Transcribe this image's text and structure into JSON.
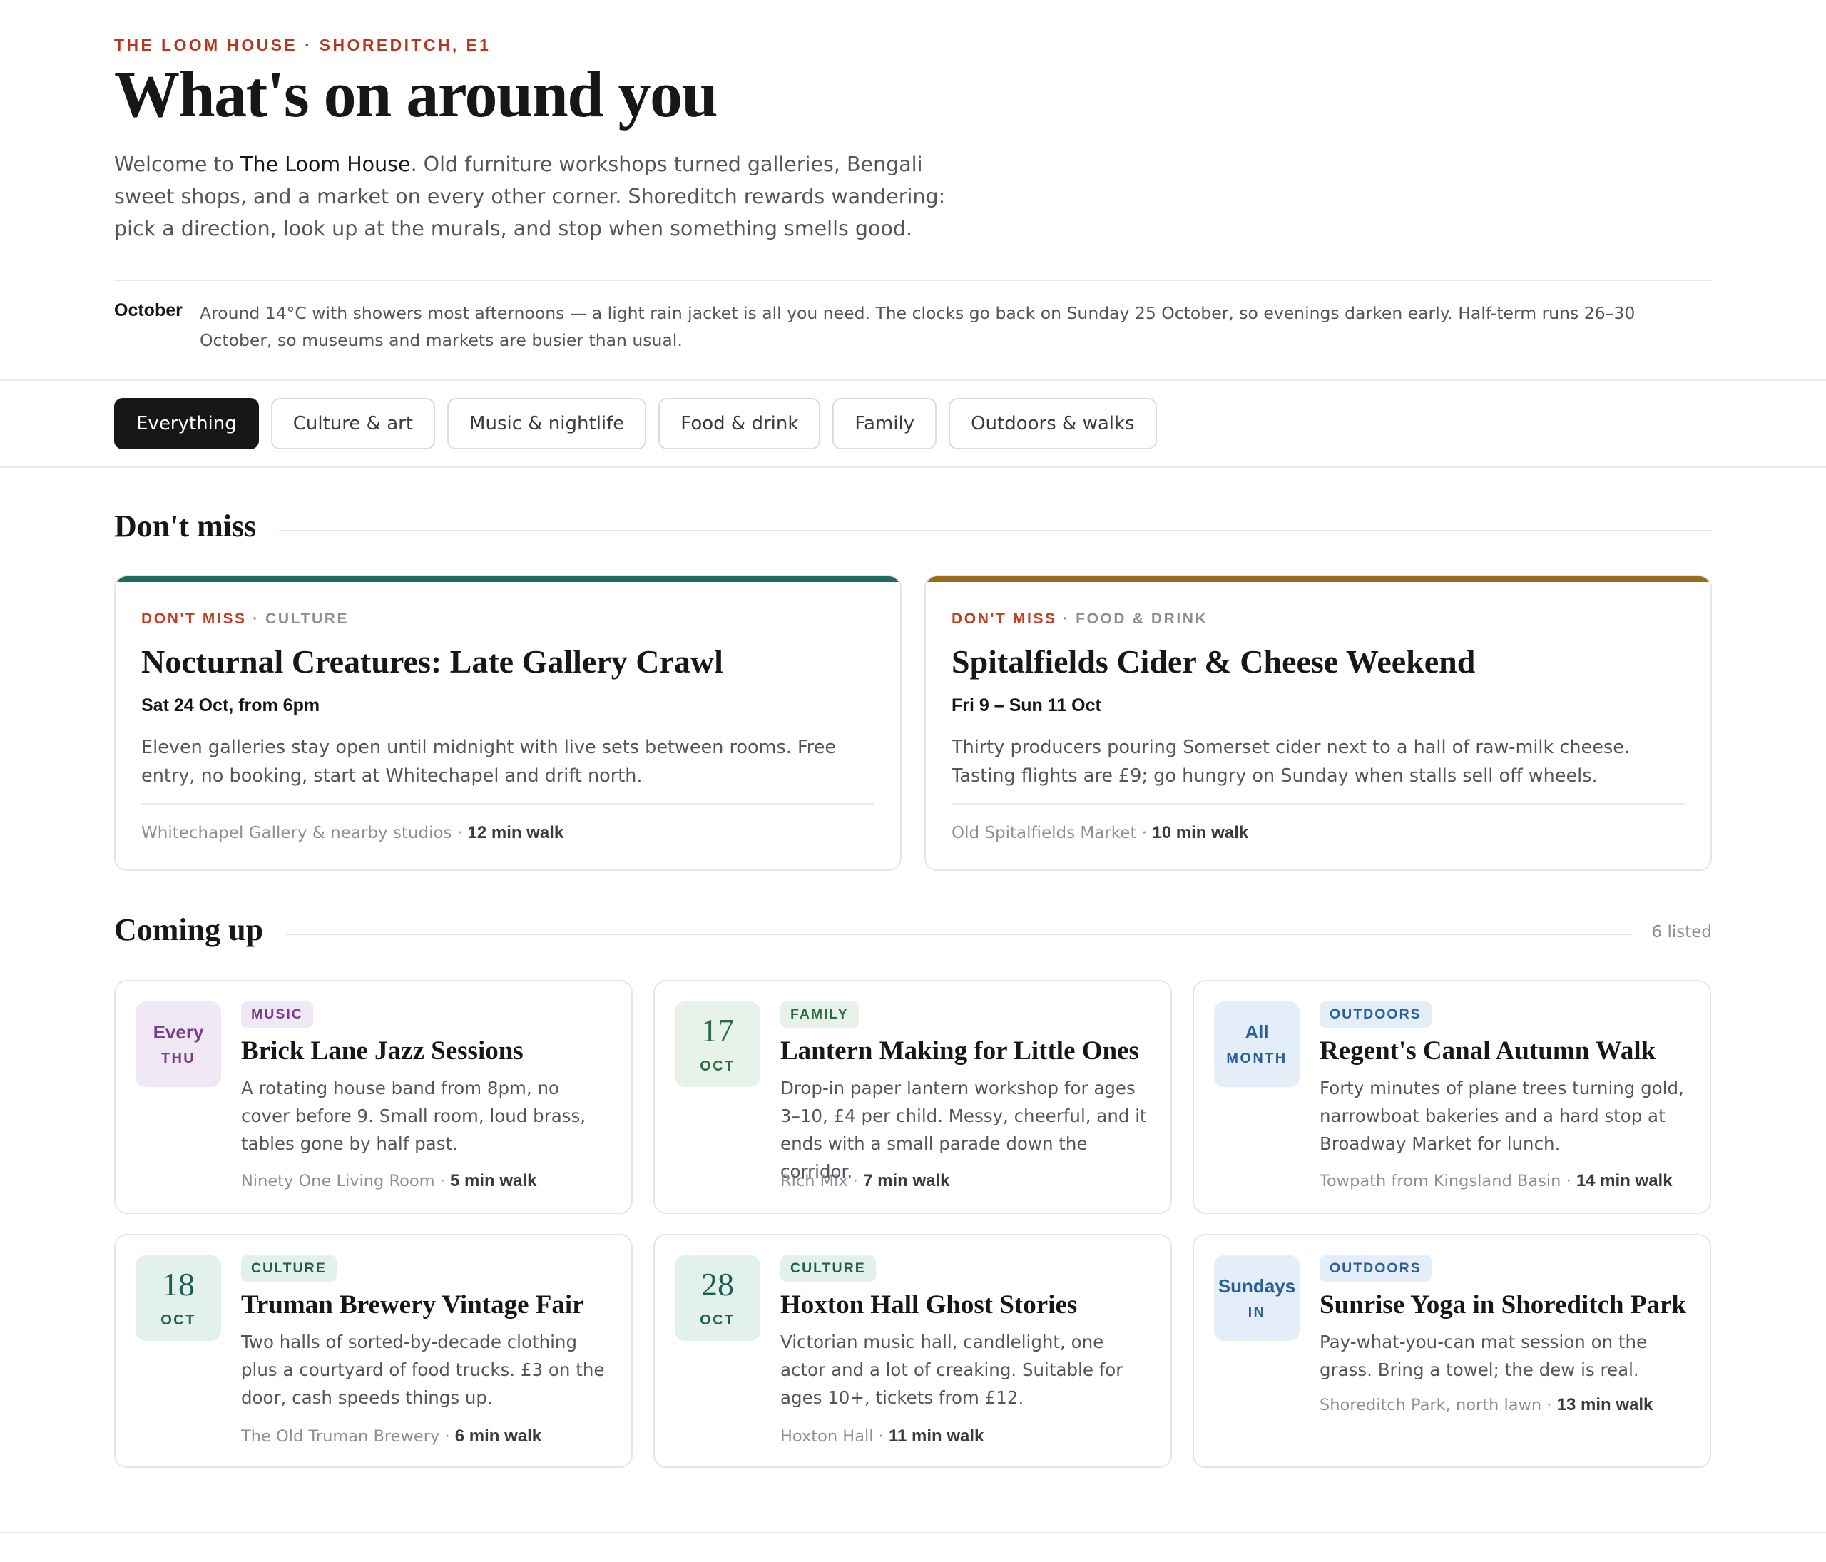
{
  "header": {
    "eyebrow": "THE LOOM HOUSE · SHOREDITCH, E1",
    "title": "What's on around you",
    "intro_prefix": "Welcome to ",
    "intro_name": "The Loom House",
    "intro_rest": ". Old furniture workshops turned galleries, Bengali sweet shops, and a market on every other corner. Shoreditch rewards wandering: pick a direction, look up at the murals, and stop when something smells good."
  },
  "month": {
    "label": "October",
    "text": "Around 14°C with showers most afternoons — a light rain jacket is all you need. The clocks go back on Sunday 25 October, so evenings darken early. Half-term runs 26–30 October, so museums and markets are busier than usual."
  },
  "filters": [
    {
      "label": "Everything",
      "active": true
    },
    {
      "label": "Culture & art",
      "active": false
    },
    {
      "label": "Music & nightlife",
      "active": false
    },
    {
      "label": "Food & drink",
      "active": false
    },
    {
      "label": "Family",
      "active": false
    },
    {
      "label": "Outdoors & walks",
      "active": false
    }
  ],
  "dont_miss": {
    "heading": "Don't miss",
    "items": [
      {
        "kicker": "DON'T MISS",
        "category": "· CULTURE",
        "title": "Nocturnal Creatures: Late Gallery Crawl",
        "date": "Sat 24 Oct, from 6pm",
        "description": "Eleven galleries stay open until midnight with live sets between rooms. Free entry, no booking, start at Whitechapel and drift north.",
        "venue": "Whitechapel Gallery & nearby studios · ",
        "walk": "12 min walk",
        "accent": "#1f6b5c"
      },
      {
        "kicker": "DON'T MISS",
        "category": "· FOOD & DRINK",
        "title": "Spitalfields Cider & Cheese Weekend",
        "date": "Fri 9 – Sun 11 Oct",
        "description": "Thirty producers pouring Somerset cider next to a hall of raw-milk cheese. Tasting flights are £9; go hungry on Sunday when stalls sell off wheels.",
        "venue": "Old Spitalfields Market · ",
        "walk": "10 min walk",
        "accent": "#9a6b1a"
      }
    ]
  },
  "coming_up": {
    "heading": "Coming up",
    "count": "6 listed",
    "events": [
      {
        "date_big": "Every",
        "date_small": "THU",
        "date_is_word": true,
        "tag": "MUSIC",
        "title": "Brick Lane Jazz Sessions",
        "description": "A rotating house band from 8pm, no cover before 9. Small room, loud brass, tables gone by half past.",
        "venue": "Ninety One Living Room · ",
        "walk": "5 min walk",
        "box_bg": "#f1e8f5",
        "box_fg": "#7a3d8c",
        "tag_bg": "#f1e8f5",
        "tag_fg": "#7a3d8c"
      },
      {
        "date_big": "17",
        "date_small": "OCT",
        "date_is_word": false,
        "tag": "FAMILY",
        "title": "Lantern Making for Little Ones",
        "description": "Drop-in paper lantern workshop for ages 3–10, £4 per child. Messy, cheerful, and it ends with a small parade down the corridor.",
        "venue": "Rich Mix · ",
        "walk": "7 min walk",
        "box_bg": "#e6f2ea",
        "box_fg": "#2f6b43",
        "tag_bg": "#e6f2ea",
        "tag_fg": "#2f6b43"
      },
      {
        "date_big": "All",
        "date_small": "MONTH",
        "date_is_word": true,
        "tag": "OUTDOORS",
        "title": "Regent's Canal Autumn Walk",
        "description": "Forty minutes of plane trees turning gold, narrowboat bakeries and a hard stop at Broadway Market for lunch.",
        "venue": "Towpath from Kingsland Basin · ",
        "walk": "14 min walk",
        "box_bg": "#e4eef8",
        "box_fg": "#2a5e9a",
        "tag_bg": "#e4eef8",
        "tag_fg": "#2a5e9a"
      },
      {
        "date_big": "18",
        "date_small": "OCT",
        "date_is_word": false,
        "tag": "CULTURE",
        "title": "Truman Brewery Vintage Fair",
        "description": "Two halls of sorted-by-decade clothing plus a courtyard of food trucks. £3 on the door, cash speeds things up.",
        "venue": "The Old Truman Brewery · ",
        "walk": "6 min walk",
        "box_bg": "#e3f1ec",
        "box_fg": "#1f5e50",
        "tag_bg": "#e3f1ec",
        "tag_fg": "#1f5e50"
      },
      {
        "date_big": "28",
        "date_small": "OCT",
        "date_is_word": false,
        "tag": "CULTURE",
        "title": "Hoxton Hall Ghost Stories",
        "description": "Victorian music hall, candlelight, one actor and a lot of creaking. Suitable for ages 10+, tickets from £12.",
        "venue": "Hoxton Hall · ",
        "walk": "11 min walk",
        "box_bg": "#e3f1ec",
        "box_fg": "#1f5e50",
        "tag_bg": "#e3f1ec",
        "tag_fg": "#1f5e50"
      },
      {
        "date_big": "Sundays",
        "date_small": "IN",
        "date_is_word": true,
        "tag": "OUTDOORS",
        "title": "Sunrise Yoga in Shoreditch Park",
        "description": "Pay-what-you-can mat session on the grass. Bring a towel; the dew is real.",
        "venue": "Shoreditch Park, north lawn · ",
        "walk": "13 min walk",
        "box_bg": "#e4eef8",
        "box_fg": "#2a5e9a",
        "tag_bg": "#e4eef8",
        "tag_fg": "#2a5e9a"
      }
    ]
  }
}
